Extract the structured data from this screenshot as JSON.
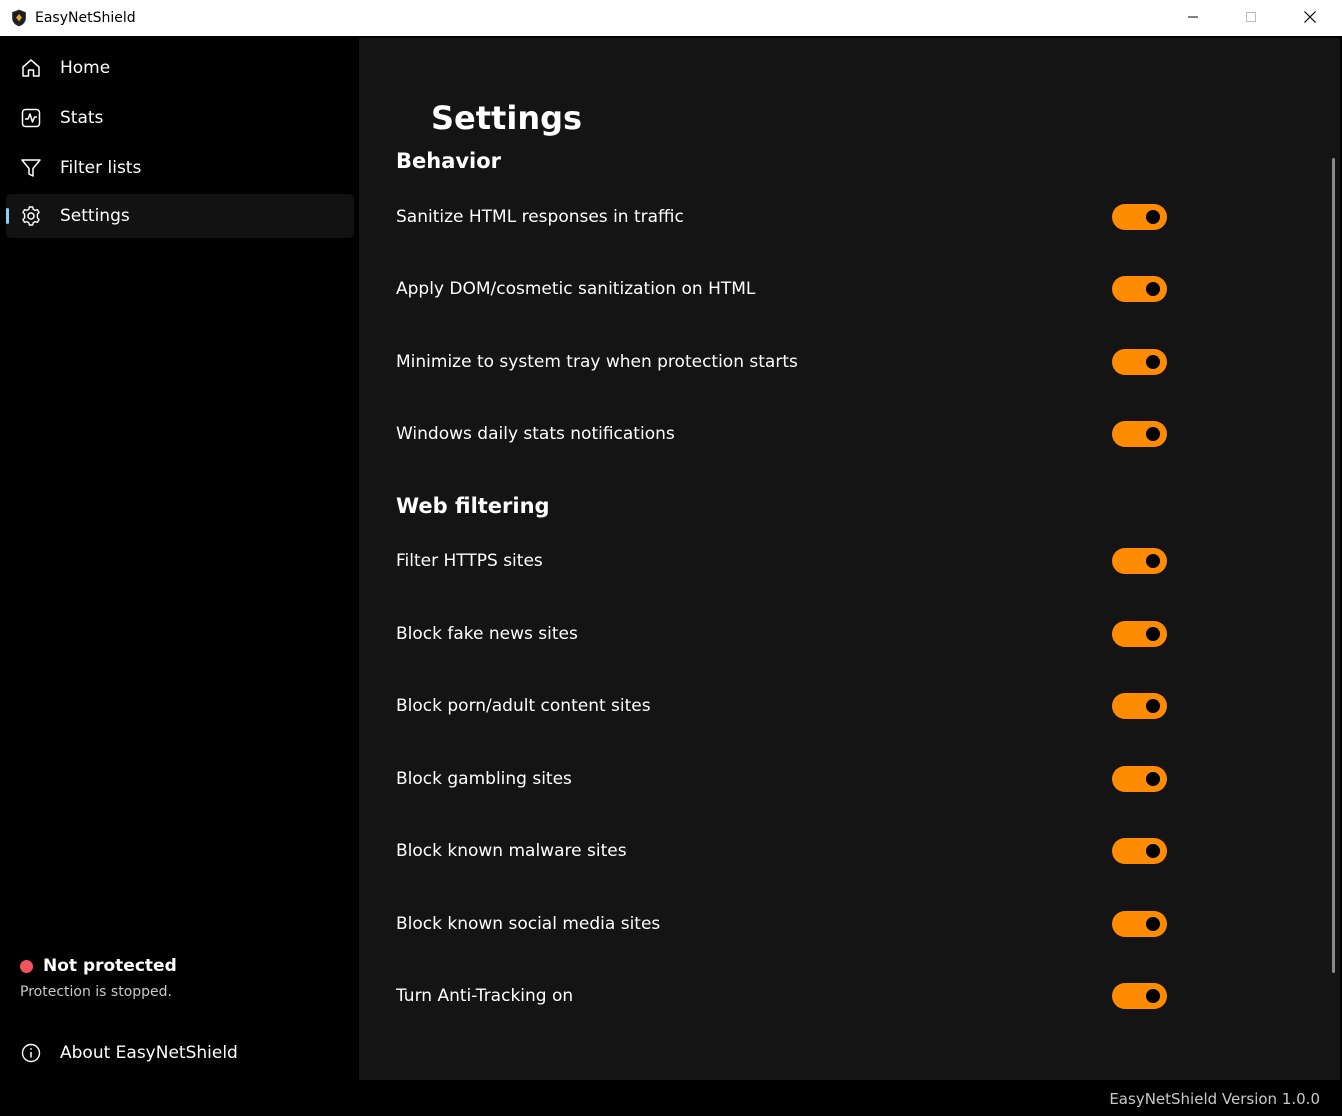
{
  "window": {
    "title": "EasyNetShield"
  },
  "sidebar": {
    "items": [
      {
        "label": "Home",
        "icon": "home-icon"
      },
      {
        "label": "Stats",
        "icon": "stats-icon"
      },
      {
        "label": "Filter lists",
        "icon": "filter-icon"
      },
      {
        "label": "Settings",
        "icon": "gear-icon",
        "active": true
      }
    ],
    "status": {
      "title": "Not protected",
      "subtitle": "Protection is stopped.",
      "color": "#f2545f"
    },
    "about_label": "About EasyNetShield"
  },
  "main": {
    "title": "Settings",
    "sections": [
      {
        "title": "Behavior",
        "settings": [
          {
            "label": "Sanitize HTML responses in traffic",
            "on": true
          },
          {
            "label": "Apply DOM/cosmetic sanitization on HTML",
            "on": true
          },
          {
            "label": "Minimize to system tray when protection starts",
            "on": true
          },
          {
            "label": "Windows daily stats notifications",
            "on": true
          }
        ]
      },
      {
        "title": "Web filtering",
        "settings": [
          {
            "label": "Filter HTTPS sites",
            "on": true
          },
          {
            "label": "Block fake news sites",
            "on": true
          },
          {
            "label": "Block porn/adult content sites",
            "on": true
          },
          {
            "label": "Block gambling sites",
            "on": true
          },
          {
            "label": "Block known malware sites",
            "on": true
          },
          {
            "label": "Block known social media sites",
            "on": true
          },
          {
            "label": "Turn Anti-Tracking on",
            "on": true
          }
        ]
      }
    ]
  },
  "footer": {
    "version": "EasyNetShield Version 1.0.0"
  },
  "colors": {
    "accent": "#ff8c00",
    "nav_indicator": "#8ecdf2",
    "content_bg": "#141414",
    "sidebar_bg": "#000000"
  }
}
